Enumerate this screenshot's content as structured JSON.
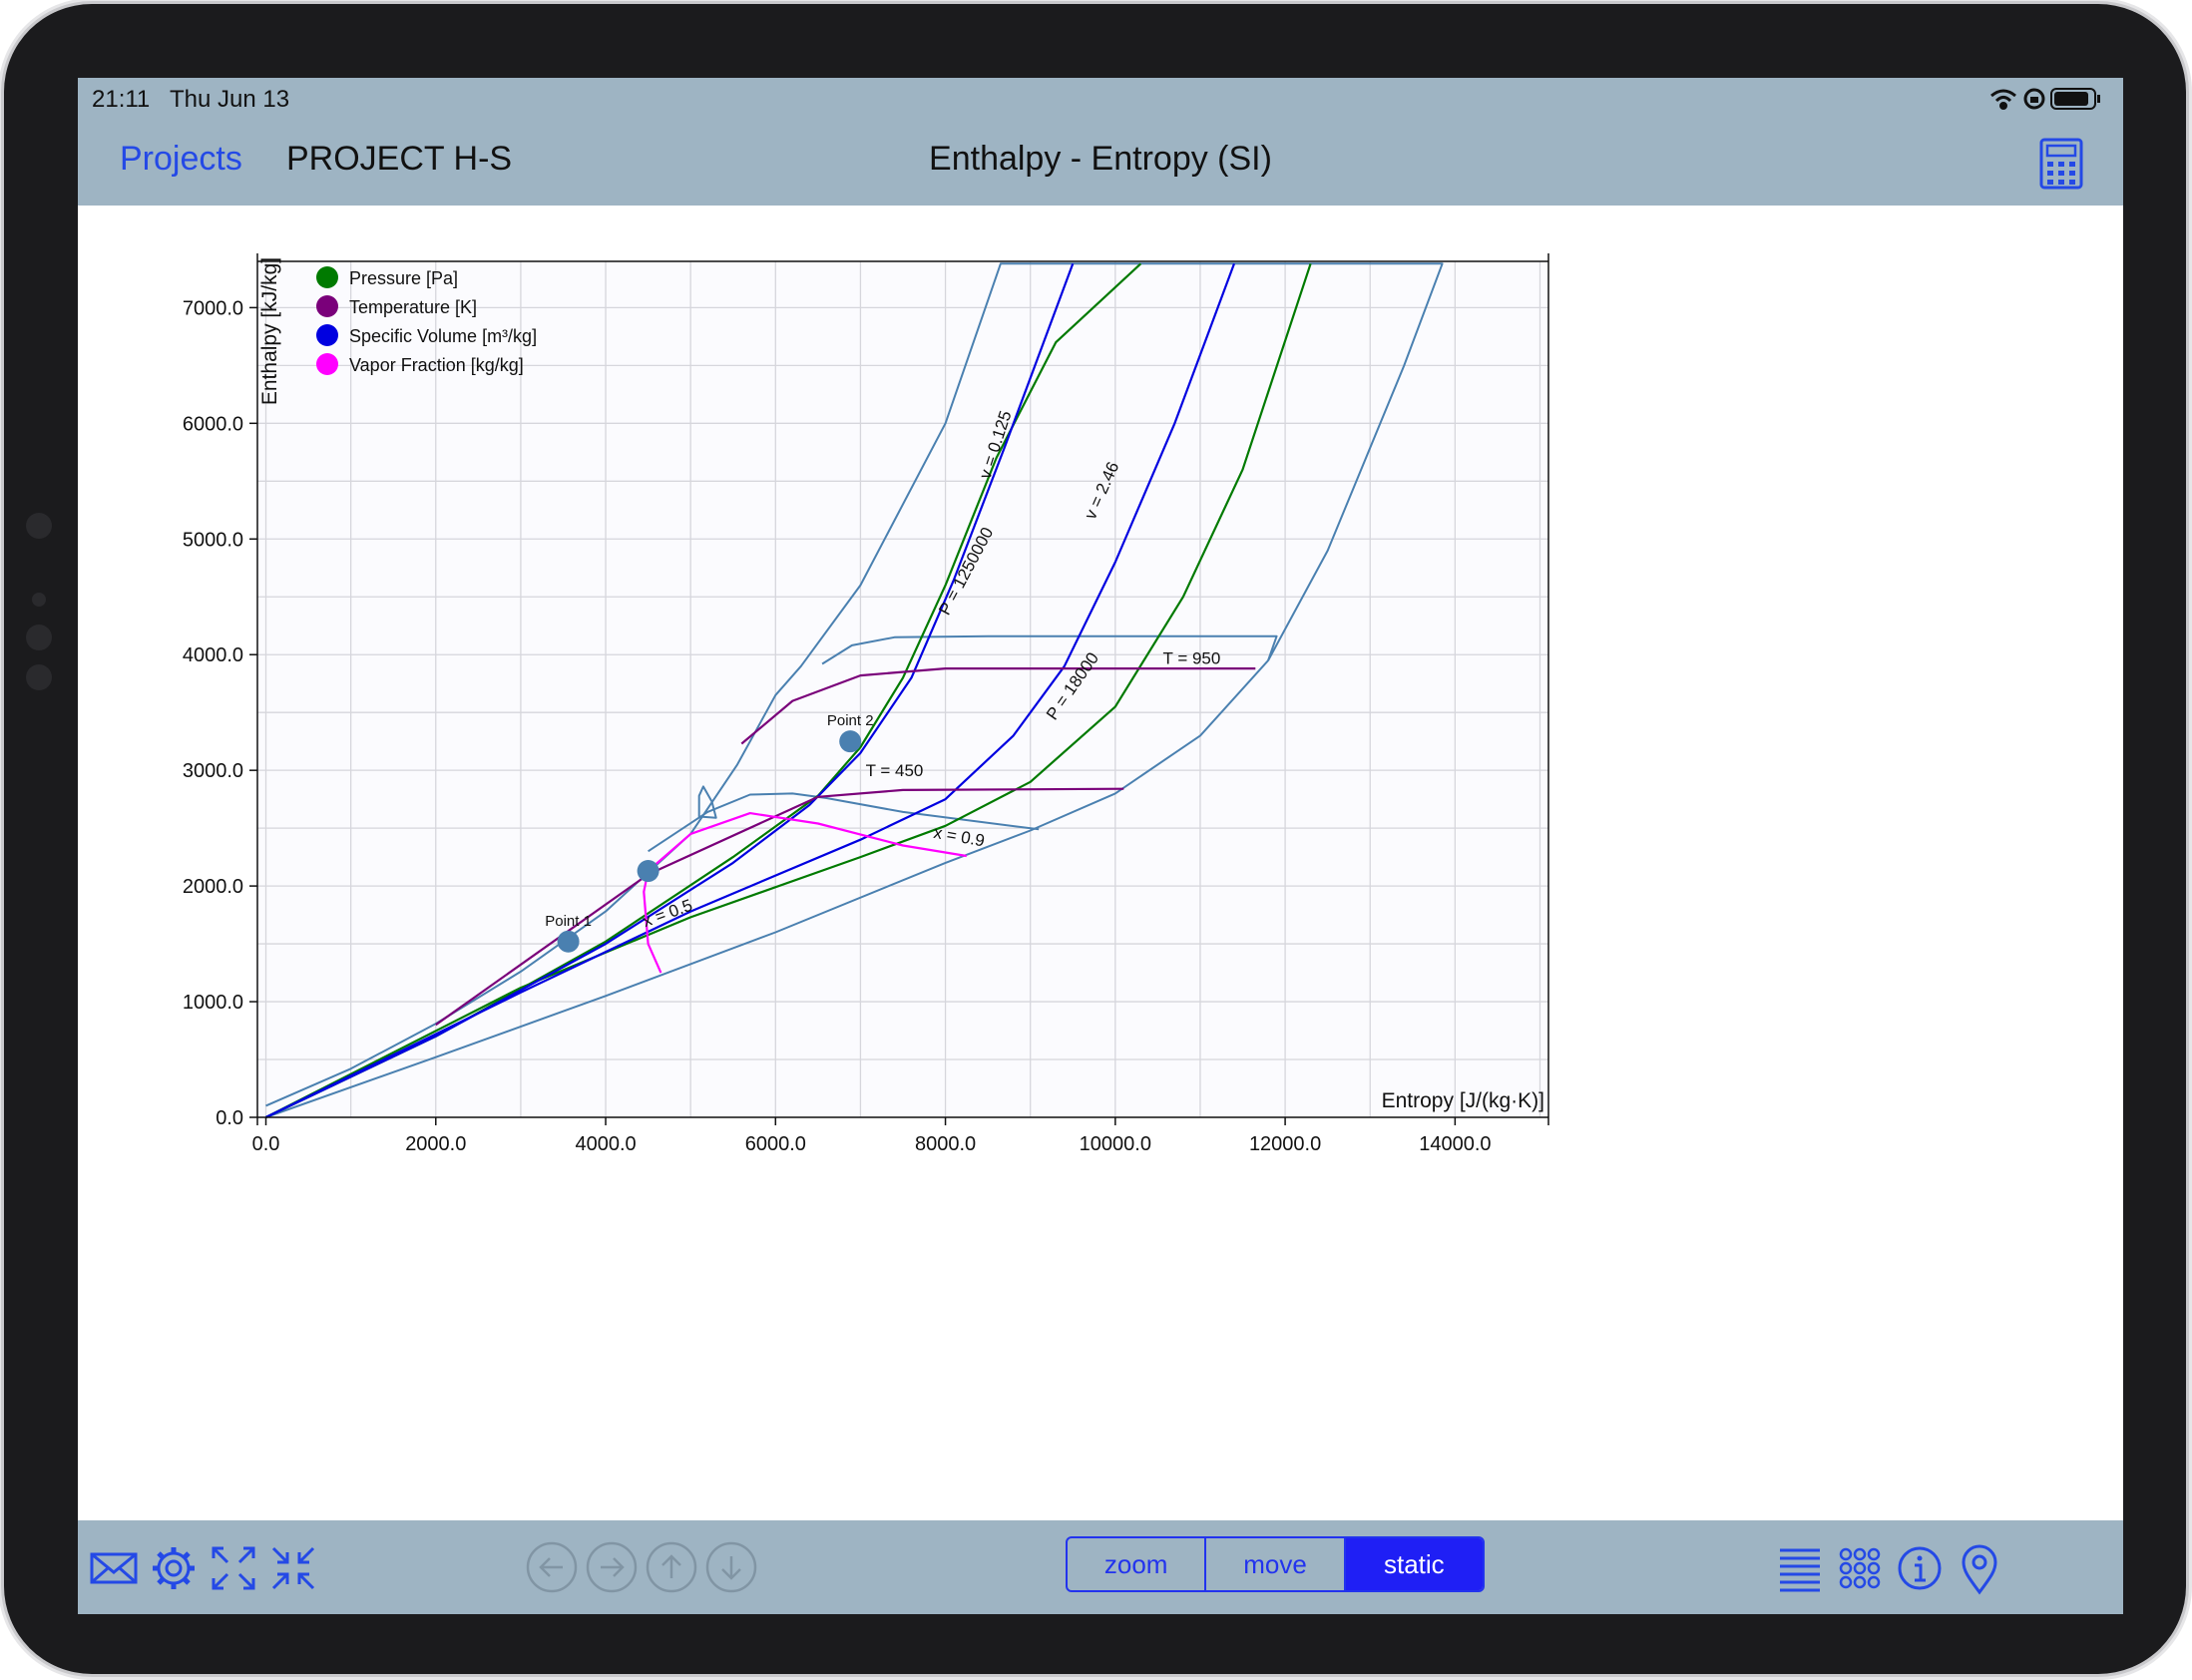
{
  "status_bar": {
    "time": "21:11",
    "date": "Thu Jun 13"
  },
  "nav": {
    "back_label": "Projects",
    "project_name": "PROJECT H-S",
    "title": "Enthalpy - Entropy (SI)"
  },
  "toolbar": {
    "icons": [
      "mail-icon",
      "gear-icon",
      "expand-icon",
      "collapse-icon",
      "arrow-left-icon",
      "arrow-right-icon",
      "arrow-up-icon",
      "arrow-down-icon",
      "list-icon",
      "grid-icon",
      "info-icon",
      "location-pin-icon"
    ],
    "segments": [
      {
        "label": "zoom",
        "selected": false
      },
      {
        "label": "move",
        "selected": false
      },
      {
        "label": "static",
        "selected": true
      }
    ]
  },
  "colors": {
    "bar": "#9eb4c3",
    "accent": "#2449e6",
    "pressure": "#007a00",
    "temperature": "#7a007a",
    "volume": "#0000e0",
    "vapor_fraction": "#ff00ff",
    "outline": "#4a80b0"
  },
  "chart_data": {
    "type": "line",
    "xlabel": "Entropy [J/(kg·K)]",
    "ylabel": "Enthalpy [kJ/kg]",
    "xlim": [
      -100,
      15100
    ],
    "ylim": [
      0,
      7400
    ],
    "xticks": [
      0,
      2000,
      4000,
      6000,
      8000,
      10000,
      12000,
      14000
    ],
    "xtick_labels": [
      "0.0",
      "2000.0",
      "4000.0",
      "6000.0",
      "8000.0",
      "10000.0",
      "12000.0",
      "14000.0"
    ],
    "yticks": [
      0,
      1000,
      2000,
      3000,
      4000,
      5000,
      6000,
      7000
    ],
    "ytick_labels": [
      "0.0",
      "1000.0",
      "2000.0",
      "3000.0",
      "4000.0",
      "5000.0",
      "6000.0",
      "7000.0"
    ],
    "grid": true,
    "legend_position": "top-left",
    "legend": [
      {
        "label": "Pressure [Pa]",
        "color": "#007a00"
      },
      {
        "label": "Temperature [K]",
        "color": "#7a007a"
      },
      {
        "label": "Specific Volume [m³/kg]",
        "color": "#0000e0"
      },
      {
        "label": "Vapor Fraction [kg/kg]",
        "color": "#ff00ff"
      }
    ],
    "series": [
      {
        "kind": "envelope",
        "color": "#4a80b0",
        "points": [
          [
            0,
            100
          ],
          [
            1000,
            420
          ],
          [
            2000,
            810
          ],
          [
            3000,
            1260
          ],
          [
            4000,
            1780
          ],
          [
            5000,
            2450
          ],
          [
            5550,
            3050
          ],
          [
            6000,
            3650
          ],
          [
            6300,
            3900
          ],
          [
            7000,
            4600
          ],
          [
            8000,
            6000
          ],
          [
            8650,
            7380
          ],
          [
            13850,
            7380
          ],
          [
            13400,
            6500
          ],
          [
            12500,
            4900
          ],
          [
            11800,
            3950
          ],
          [
            11000,
            3300
          ],
          [
            10000,
            2800
          ],
          [
            9000,
            2480
          ],
          [
            8000,
            2200
          ],
          [
            6000,
            1600
          ],
          [
            4000,
            1050
          ],
          [
            2000,
            520
          ],
          [
            0,
            0
          ]
        ]
      },
      {
        "kind": "envelope",
        "color": "#4a80b0",
        "points": [
          [
            4500,
            2300
          ],
          [
            5200,
            2640
          ],
          [
            5700,
            2790
          ],
          [
            6200,
            2800
          ],
          [
            6600,
            2760
          ],
          [
            7500,
            2640
          ],
          [
            9100,
            2490
          ]
        ]
      },
      {
        "kind": "envelope",
        "color": "#4a80b0",
        "points": [
          [
            5100,
            2650
          ],
          [
            5100,
            2600
          ],
          [
            5300,
            2590
          ],
          [
            5250,
            2730
          ],
          [
            5150,
            2860
          ],
          [
            5100,
            2780
          ],
          [
            5100,
            2650
          ]
        ]
      },
      {
        "kind": "envelope",
        "color": "#4a80b0",
        "points": [
          [
            6550,
            3920
          ],
          [
            6900,
            4080
          ],
          [
            7400,
            4150
          ],
          [
            8500,
            4160
          ],
          [
            11900,
            4160
          ],
          [
            11800,
            3950
          ]
        ]
      },
      {
        "kind": "pressure",
        "label": "P = 1250000",
        "label_at": [
          8300,
          4700
        ],
        "label_angle": -62,
        "color": "#007a00",
        "points": [
          [
            0,
            0
          ],
          [
            2000,
            700
          ],
          [
            4000,
            1520
          ],
          [
            5500,
            2250
          ],
          [
            6500,
            2780
          ],
          [
            7000,
            3200
          ],
          [
            7500,
            3800
          ],
          [
            8000,
            4600
          ],
          [
            8600,
            5700
          ],
          [
            9300,
            6700
          ],
          [
            10300,
            7380
          ]
        ]
      },
      {
        "kind": "pressure",
        "label": "P = 18000",
        "label_at": [
          9550,
          3700
        ],
        "label_angle": -55,
        "color": "#007a00",
        "points": [
          [
            0,
            0
          ],
          [
            3000,
            1120
          ],
          [
            5000,
            1730
          ],
          [
            7000,
            2250
          ],
          [
            8000,
            2520
          ],
          [
            9000,
            2900
          ],
          [
            10000,
            3550
          ],
          [
            10800,
            4500
          ],
          [
            11500,
            5600
          ],
          [
            12300,
            7380
          ]
        ]
      },
      {
        "kind": "volume",
        "label": "v = 0.125",
        "label_at": [
          8650,
          5800
        ],
        "label_angle": -72,
        "color": "#0000e0",
        "points": [
          [
            0,
            0
          ],
          [
            2000,
            700
          ],
          [
            4000,
            1500
          ],
          [
            5500,
            2200
          ],
          [
            6400,
            2700
          ],
          [
            7000,
            3150
          ],
          [
            7600,
            3800
          ],
          [
            8100,
            4650
          ],
          [
            8700,
            5800
          ],
          [
            9500,
            7380
          ]
        ]
      },
      {
        "kind": "volume",
        "label": "v = 2.46",
        "label_at": [
          9900,
          5400
        ],
        "label_angle": -66,
        "color": "#0000e0",
        "points": [
          [
            0,
            0
          ],
          [
            3000,
            1080
          ],
          [
            5000,
            1780
          ],
          [
            7000,
            2400
          ],
          [
            8000,
            2750
          ],
          [
            8800,
            3300
          ],
          [
            9400,
            3900
          ],
          [
            10000,
            4800
          ],
          [
            10700,
            6000
          ],
          [
            11400,
            7380
          ]
        ]
      },
      {
        "kind": "temperature",
        "label": "T = 450",
        "label_at": [
          7400,
          2950
        ],
        "label_angle": 0,
        "color": "#7a007a",
        "points": [
          [
            2000,
            800
          ],
          [
            4500,
            2100
          ],
          [
            6500,
            2770
          ],
          [
            7500,
            2830
          ],
          [
            10100,
            2840
          ]
        ]
      },
      {
        "kind": "temperature",
        "label": "T = 950",
        "label_at": [
          10900,
          3920
        ],
        "label_angle": 0,
        "color": "#7a007a",
        "points": [
          [
            5600,
            3230
          ],
          [
            6200,
            3600
          ],
          [
            7000,
            3820
          ],
          [
            8000,
            3880
          ],
          [
            11650,
            3880
          ]
        ]
      },
      {
        "kind": "vapor_fraction",
        "label": "x = 0.5",
        "label_at": [
          4750,
          1720
        ],
        "label_angle": -20,
        "color": "#ff00ff",
        "points": [
          [
            4500,
            2130
          ],
          [
            4450,
            1950
          ],
          [
            4500,
            1500
          ],
          [
            4650,
            1250
          ]
        ]
      },
      {
        "kind": "vapor_fraction",
        "label": "x = 0.9",
        "label_at": [
          8150,
          2380
        ],
        "label_angle": 10,
        "color": "#ff00ff",
        "points": [
          [
            4500,
            2130
          ],
          [
            5000,
            2450
          ],
          [
            5700,
            2630
          ],
          [
            6500,
            2540
          ],
          [
            7500,
            2350
          ],
          [
            8250,
            2260
          ]
        ]
      }
    ],
    "points": [
      {
        "label": "Point 1",
        "x": 3560,
        "y": 1520,
        "color": "#4a80b0"
      },
      {
        "label": "",
        "x": 4500,
        "y": 2130,
        "color": "#4a80b0"
      },
      {
        "label": "Point 2",
        "x": 6880,
        "y": 3250,
        "color": "#4a80b0"
      }
    ]
  }
}
